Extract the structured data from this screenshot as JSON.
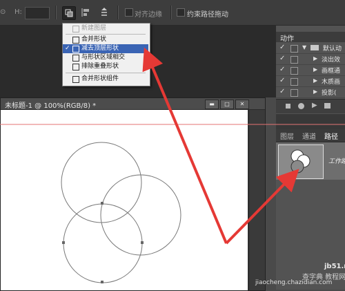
{
  "options_bar": {
    "h_label": "H:",
    "align_edges_label": "对齐边缘",
    "constrain_path_label": "约束路径拖动"
  },
  "path_operations_menu": {
    "items": [
      {
        "label": "新建图层",
        "state": "disabled"
      },
      {
        "label": "合并形状",
        "state": "normal"
      },
      {
        "label": "减去顶层形状",
        "state": "selected",
        "checked": true
      },
      {
        "label": "与形状区域相交",
        "state": "normal"
      },
      {
        "label": "排除重叠形状",
        "state": "normal"
      },
      {
        "label": "合并形状组件",
        "state": "normal"
      }
    ]
  },
  "document": {
    "title": "未标题-1 @ 100%(RGB/8) *",
    "window_buttons": [
      "▬",
      "□",
      "✕"
    ]
  },
  "actions_panel": {
    "title": "动作",
    "rows": [
      {
        "label": "默认动",
        "checked": true,
        "expanded": true
      },
      {
        "label": "淡出效",
        "checked": true,
        "expanded": false
      },
      {
        "label": "画框通",
        "checked": true,
        "expanded": false
      },
      {
        "label": "木质画",
        "checked": true,
        "expanded": false
      },
      {
        "label": "投影(",
        "checked": true,
        "expanded": false
      }
    ]
  },
  "paths_panel": {
    "tabs": [
      "图层",
      "通道",
      "路径"
    ],
    "active_tab": "路径",
    "path_name": "工作路"
  },
  "watermark": {
    "line1": "jb51.net",
    "line2": "查字典 教程网",
    "line3": "jiaocheng.chazidian.com"
  },
  "colors": {
    "annotation_arrow": "#e53935",
    "menu_highlight": "#3a64b4",
    "guide_line": "#e57373"
  }
}
